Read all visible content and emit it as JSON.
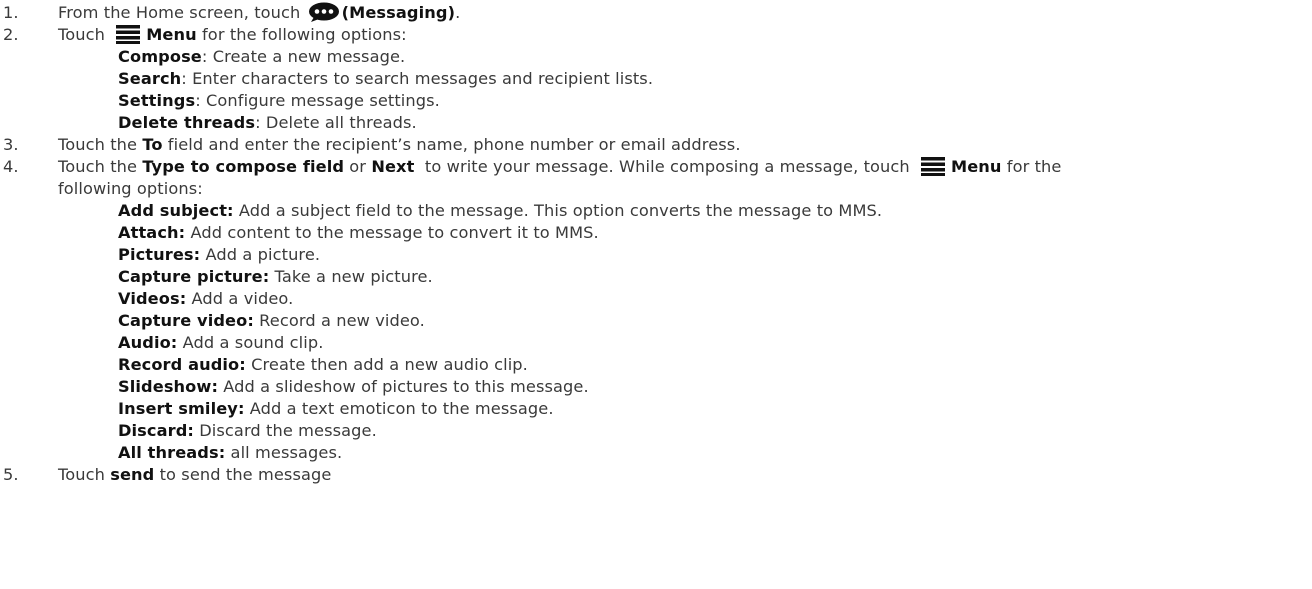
{
  "steps": [
    {
      "num": "1.",
      "before": "From the Home screen, touch ",
      "icon": "messaging-bubble-icon",
      "bold": "(Messaging)",
      "after": "."
    },
    {
      "num": "2.",
      "before": "Touch ",
      "icon": "menu-icon",
      "bold": "Menu",
      "after": " for the following options:",
      "options": [
        {
          "label": "Compose",
          "desc": ": Create a new message."
        },
        {
          "label": "Search",
          "desc": ": Enter characters to search messages and recipient lists."
        },
        {
          "label": "Settings",
          "desc": ": Configure message settings."
        },
        {
          "label": "Delete threads",
          "desc": ": Delete all threads."
        }
      ]
    },
    {
      "num": "3.",
      "before": "Touch the ",
      "bold": "To",
      "after": " field and enter the recipient’s name, phone number or email address."
    },
    {
      "num": "4.",
      "before": "Touch the ",
      "bold1": "Type to compose field",
      "mid1": " or ",
      "bold2": "Next",
      "mid2": "  to write your message. While composing a message, touch ",
      "icon": "menu-icon",
      "bold3": "Menu",
      "mid3": " for the",
      "continuation": "following options:",
      "options": [
        {
          "label": "Add subject:",
          "desc": " Add a subject field to the message. This option converts the message to MMS."
        },
        {
          "label": "Attach:",
          "desc": " Add content to the message to convert it to MMS."
        },
        {
          "label": "Pictures:",
          "desc": " Add a picture."
        },
        {
          "label": "Capture picture:",
          "desc": " Take a new picture."
        },
        {
          "label": "Videos:",
          "desc": " Add a video."
        },
        {
          "label": "Capture video:",
          "desc": " Record a new video."
        },
        {
          "label": "Audio:",
          "desc": " Add a sound clip."
        },
        {
          "label": "Record audio:",
          "desc": " Create then add a new audio clip."
        },
        {
          "label": "Slideshow:",
          "desc": " Add a slideshow of pictures to this message."
        },
        {
          "label": "Insert smiley:",
          "desc": " Add a text emoticon to the message."
        },
        {
          "label": "Discard:",
          "desc": " Discard the message."
        },
        {
          "label": "All threads:",
          "desc": " all messages."
        }
      ]
    },
    {
      "num": "5.",
      "before": "Touch ",
      "bold": "send",
      "after": " to send the message"
    }
  ]
}
